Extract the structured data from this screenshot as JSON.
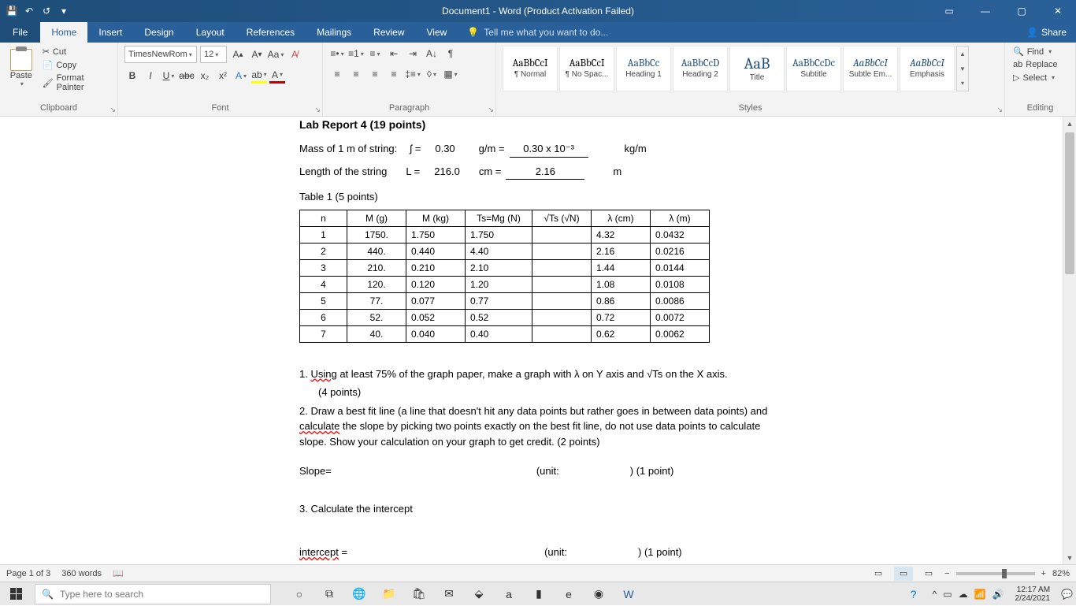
{
  "title": "Document1 - Word (Product Activation Failed)",
  "qat": {
    "save": "💾",
    "undo": "↶",
    "redo": "↺"
  },
  "tabs": {
    "file": "File",
    "home": "Home",
    "insert": "Insert",
    "design": "Design",
    "layout": "Layout",
    "references": "References",
    "mailings": "Mailings",
    "review": "Review",
    "view": "View",
    "tellme": "Tell me what you want to do...",
    "share": "Share"
  },
  "ribbon": {
    "clipboard": {
      "label": "Clipboard",
      "paste": "Paste",
      "cut": "Cut",
      "copy": "Copy",
      "format_painter": "Format Painter"
    },
    "font": {
      "label": "Font",
      "name": "TimesNewRom",
      "size": "12"
    },
    "paragraph": {
      "label": "Paragraph"
    },
    "styles": {
      "label": "Styles",
      "items": [
        {
          "preview": "AaBbCcI",
          "name": "¶ Normal"
        },
        {
          "preview": "AaBbCcI",
          "name": "¶ No Spac..."
        },
        {
          "preview": "AaBbCc",
          "name": "Heading 1"
        },
        {
          "preview": "AaBbCcD",
          "name": "Heading 2"
        },
        {
          "preview": "AaB",
          "name": "Title"
        },
        {
          "preview": "AaBbCcDc",
          "name": "Subtitle"
        },
        {
          "preview": "AaBbCcI",
          "name": "Subtle Em..."
        },
        {
          "preview": "AaBbCcI",
          "name": "Emphasis"
        }
      ]
    },
    "editing": {
      "label": "Editing",
      "find": "Find",
      "replace": "Replace",
      "select": "Select"
    }
  },
  "doc": {
    "title": "Lab Report 4 (19 points)",
    "mass_label": "Mass of 1 m of string:",
    "mass_sym": "ʃ =",
    "mass_val": "0.30",
    "gm": "g/m =",
    "mass_kg": "0.30 x 10⁻³",
    "kgm": "kg/m",
    "len_label": "Length of the string",
    "len_sym": "L =",
    "len_val": "216.0",
    "cm": "cm =",
    "len_m": "2.16",
    "m": "m",
    "table_label": "Table 1 (5 points)",
    "headers": {
      "n": "n",
      "mg": "M (g)",
      "mkg": "M (kg)",
      "ts": "Ts=Mg  (N)",
      "rt": "√Ts (√N)",
      "lcm": "λ (cm)",
      "lm": "λ (m)"
    },
    "rows": [
      {
        "n": "1",
        "mg": "1750.",
        "mkg": "1.750",
        "ts": "1.750",
        "rt": "",
        "lcm": "4.32",
        "lm": "0.0432"
      },
      {
        "n": "2",
        "mg": "440.",
        "mkg": "0.440",
        "ts": "4.40",
        "rt": "",
        "lcm": "2.16",
        "lm": "0.0216"
      },
      {
        "n": "3",
        "mg": "210.",
        "mkg": "0.210",
        "ts": "2.10",
        "rt": "",
        "lcm": "1.44",
        "lm": "0.0144"
      },
      {
        "n": "4",
        "mg": "120.",
        "mkg": "0.120",
        "ts": "1.20",
        "rt": "",
        "lcm": "1.08",
        "lm": "0.0108"
      },
      {
        "n": "5",
        "mg": "77.",
        "mkg": "0.077",
        "ts": "0.77",
        "rt": "",
        "lcm": "0.86",
        "lm": "0.0086"
      },
      {
        "n": "6",
        "mg": "52.",
        "mkg": "0.052",
        "ts": "0.52",
        "rt": "",
        "lcm": "0.72",
        "lm": "0.0072"
      },
      {
        "n": "7",
        "mg": "40.",
        "mkg": "0.040",
        "ts": "0.40",
        "rt": "",
        "lcm": "0.62",
        "lm": "0.0062"
      }
    ],
    "q1a": "1. ",
    "q1b": "Using",
    "q1c": " at least 75% of the graph paper, make a graph with λ on Y axis and √Ts on the X axis.",
    "q1d": "(4 points)",
    "q2a": "2. Draw a best fit line (a line that doesn't hit any data points but rather goes in between data points) and ",
    "q2b": "calculate",
    "q2c": " the slope by picking two points exactly on the best fit line, do not use data points to calculate slope. Show your calculation on your graph to get credit. (2 points)",
    "slope": "Slope=",
    "unit": "(unit:",
    "pt1": ") (1 point)",
    "q3": "3. Calculate the intercept",
    "intercept": "intercept",
    "eq": " ="
  },
  "status": {
    "page": "Page 1 of 3",
    "words": "360 words",
    "zoom": "82%"
  },
  "taskbar": {
    "search": "Type here to search",
    "time": "12:17 AM",
    "date": "2/24/2021"
  }
}
